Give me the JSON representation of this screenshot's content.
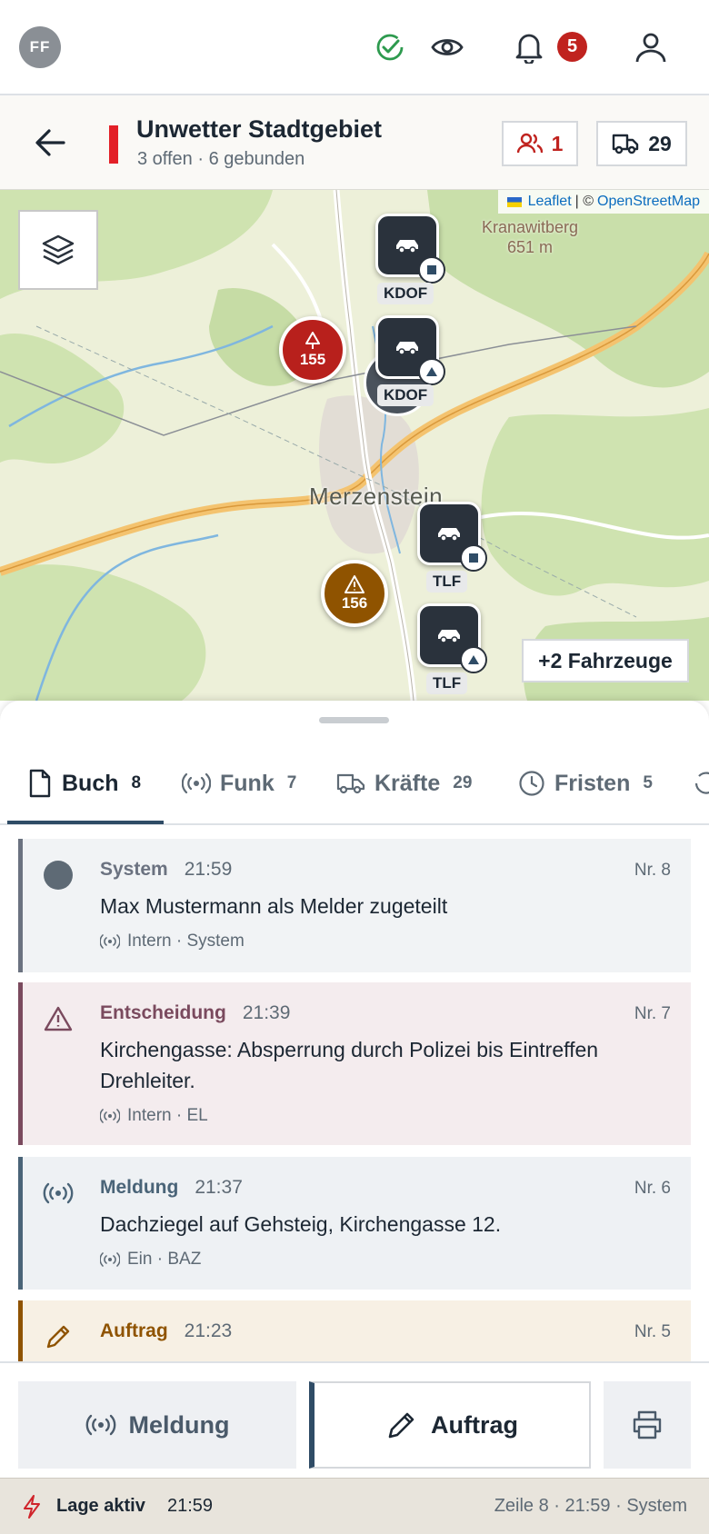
{
  "topbar": {
    "avatar_initials": "FF",
    "notification_count": "5",
    "icons": [
      "check-circle-icon",
      "eye-icon",
      "bell-icon",
      "user-icon"
    ],
    "check_color": "#2d9a4e"
  },
  "header": {
    "title": "Unwetter Stadtgebiet",
    "subtitle": "3 offen · 6 gebunden",
    "accent_color": "#e32028",
    "persons_count": "1",
    "vehicles_count": "29"
  },
  "map": {
    "attribution_leaflet": "Leaflet",
    "attribution_sep": "| ©",
    "attribution_osm": "OpenStreetMap",
    "place_name": "Merzenstein",
    "peak_name": "Kranawitberg",
    "peak_height": "651 m",
    "incidents": [
      {
        "number": "155",
        "icon": "tree-icon",
        "color": "#b8201c"
      },
      {
        "number": "156",
        "icon": "warning-icon",
        "color": "#8f5300"
      }
    ],
    "vehicles": [
      {
        "label": "KDOF",
        "status": "square"
      },
      {
        "label": "KDOF",
        "status": "triangle"
      },
      {
        "label": "TLF",
        "status": "square"
      },
      {
        "label": "TLF",
        "status": "triangle"
      }
    ],
    "more_vehicles": "+2 Fahrzeuge"
  },
  "tabs": [
    {
      "label": "Buch",
      "count": "8",
      "icon": "document-icon"
    },
    {
      "label": "Funk",
      "count": "7",
      "icon": "radio-icon"
    },
    {
      "label": "Kräfte",
      "count": "29",
      "icon": "truck-icon"
    },
    {
      "label": "Fristen",
      "count": "5",
      "icon": "clock-icon"
    }
  ],
  "entries": [
    {
      "type": "System",
      "time": "21:59",
      "nr": "Nr. 8",
      "text": "Max Mustermann als Melder zugeteilt",
      "meta": "Intern · System",
      "color": "#6b7280"
    },
    {
      "type": "Entscheidung",
      "time": "21:39",
      "nr": "Nr. 7",
      "text": "Kirchengasse: Absperrung durch Polizei bis Eintreffen Drehleiter.",
      "meta": "Intern · EL",
      "color": "#7a4a5e"
    },
    {
      "type": "Meldung",
      "time": "21:37",
      "nr": "Nr. 6",
      "text": "Dachziegel auf Gehsteig, Kirchengasse 12.",
      "meta": "Ein · BAZ",
      "color": "#4a6478"
    },
    {
      "type": "Auftrag",
      "time": "21:23",
      "nr": "Nr. 5",
      "text": "",
      "meta": "",
      "color": "#8f5300"
    }
  ],
  "bottom": {
    "meldung_label": "Meldung",
    "auftrag_label": "Auftrag"
  },
  "status": {
    "label": "Lage aktiv",
    "time": "21:59",
    "right": "Zeile 8 · 21:59 · System"
  }
}
